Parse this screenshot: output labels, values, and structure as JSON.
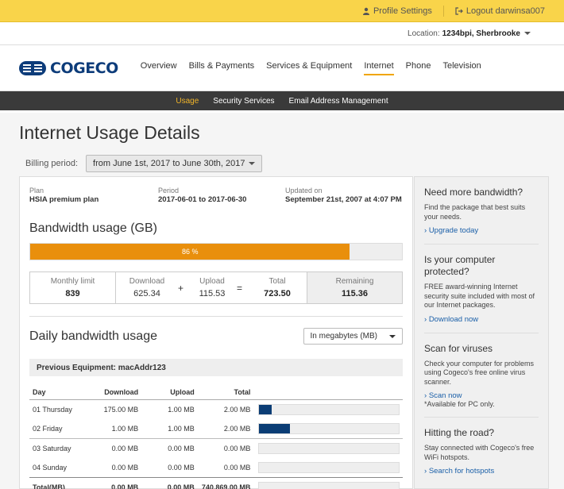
{
  "topbar": {
    "profile_label": "Profile Settings",
    "logout_label": "Logout darwinsa007"
  },
  "location": {
    "label": "Location:",
    "value": "1234bpi, Sherbrooke"
  },
  "brand": {
    "name": "COGECO"
  },
  "nav": [
    {
      "label": "Overview"
    },
    {
      "label": "Bills & Payments"
    },
    {
      "label": "Services & Equipment"
    },
    {
      "label": "Internet"
    },
    {
      "label": "Phone"
    },
    {
      "label": "Television"
    }
  ],
  "subnav": [
    {
      "label": "Usage"
    },
    {
      "label": "Security Services"
    },
    {
      "label": "Email Address Management"
    }
  ],
  "page": {
    "title": "Internet Usage Details",
    "billing_label": "Billing period:",
    "billing_value": "from June 1st, 2017 to June 30th, 2017"
  },
  "meta": {
    "plan_label": "Plan",
    "plan_value": "HSIA premium plan",
    "period_label": "Period",
    "period_value": "2017-06-01 to 2017-06-30",
    "updated_label": "Updated on",
    "updated_value": "September 21st, 2007 at 4:07 PM"
  },
  "bandwidth": {
    "title": "Bandwidth usage (GB)",
    "percent": 86,
    "percent_label": "86 %",
    "monthly_limit_label": "Monthly limit",
    "monthly_limit": "839",
    "download_label": "Download",
    "download": "625.34",
    "upload_label": "Upload",
    "upload": "115.53",
    "total_label": "Total",
    "total": "723.50",
    "remaining_label": "Remaining",
    "remaining": "115.36",
    "plus": "+",
    "equals": "="
  },
  "daily": {
    "title": "Daily bandwidth usage",
    "unit_select": "In megabytes (MB)",
    "equipment": "Previous Equipment: macAddr123",
    "headers": {
      "day": "Day",
      "download": "Download",
      "upload": "Upload",
      "total": "Total"
    },
    "rows": [
      {
        "day": "01  Thursday",
        "download": "175.00 MB",
        "upload": "1.00 MB",
        "total": "2.00 MB",
        "fill": 0.09
      },
      {
        "day": "02  Friday",
        "download": "1.00 MB",
        "upload": "1.00 MB",
        "total": "2.00 MB",
        "fill": 0.22
      },
      {
        "day": "03  Saturday",
        "download": "0.00 MB",
        "upload": "0.00 MB",
        "total": "0.00 MB",
        "fill": 0
      },
      {
        "day": "04  Sunday",
        "download": "0.00 MB",
        "upload": "0.00 MB",
        "total": "0.00 MB",
        "fill": 0
      }
    ],
    "total_row": {
      "day": "Total(MB)",
      "download": "0.00 MB",
      "upload": "0.00 MB",
      "total": "740,869.00 MB",
      "fill": 0
    }
  },
  "sidebar": [
    {
      "title": "Need more bandwidth?",
      "text": "Find the package that best suits your needs.",
      "link": "Upgrade today",
      "note": ""
    },
    {
      "title": "Is your computer protected?",
      "text": "FREE award-winning Internet security suite included with most of our Internet packages.",
      "link": "Download now",
      "note": ""
    },
    {
      "title": "Scan for viruses",
      "text": "Check your computer for problems using Cogeco's free online virus scanner.",
      "link": "Scan now",
      "note": "*Available for PC only."
    },
    {
      "title": "Hitting the road?",
      "text": "Stay connected with Cogeco's free WiFi hotspots.",
      "link": "Search for hotspots",
      "note": ""
    }
  ],
  "colors": {
    "topbar": "#f9d44a",
    "brand_blue": "#0d3c7a",
    "progress_orange": "#e98f0c",
    "bar_blue": "#0b3d75",
    "subnav_active": "#f0b429"
  }
}
